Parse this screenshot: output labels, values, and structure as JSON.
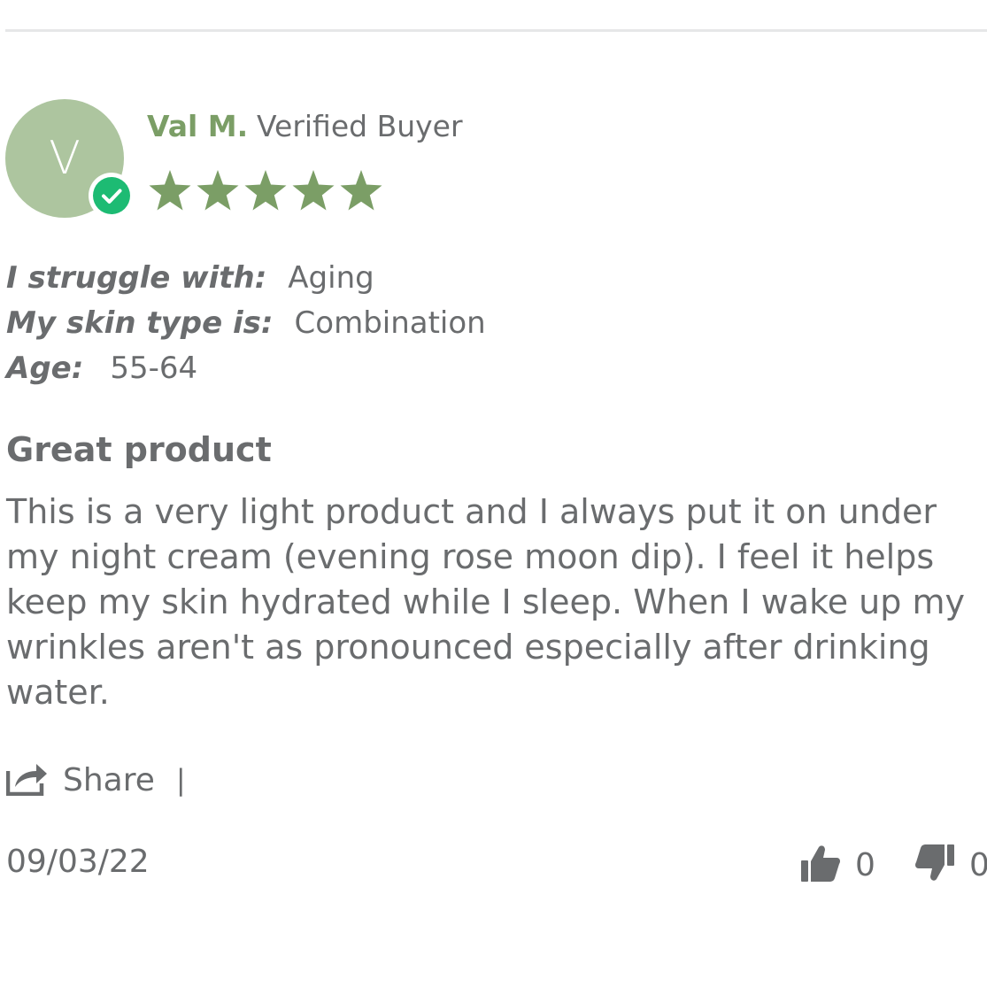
{
  "review": {
    "avatar_initial": "V",
    "author": "Val M.",
    "verified_label": "Verified Buyer",
    "rating": 5,
    "rating_max": 5,
    "star_color": "#7b9e66",
    "attributes": [
      {
        "label": "I struggle with:",
        "value": "Aging"
      },
      {
        "label": "My skin type is:",
        "value": "Combination"
      },
      {
        "label": "Age:",
        "value": "55-64"
      }
    ],
    "title": "Great product",
    "body": "This is a very light product and I always put it on under my night cream (evening rose moon dip). I feel it helps keep my skin hydrated while I sleep. When I wake up my wrinkles aren't as pronounced especially after drinking water.",
    "share_label": "Share",
    "share_separator": "|",
    "date": "09/03/22",
    "helpful_count": "0",
    "unhelpful_count": "0"
  },
  "icons": {
    "verified": "check-circle-icon",
    "star": "star-icon",
    "share": "share-icon",
    "thumbs_up": "thumbs-up-icon",
    "thumbs_down": "thumbs-down-icon"
  },
  "colors": {
    "author": "#7b9e66",
    "avatar_bg": "#adc59f",
    "verified_badge": "#1dbb73",
    "text": "#6a6c6e"
  }
}
